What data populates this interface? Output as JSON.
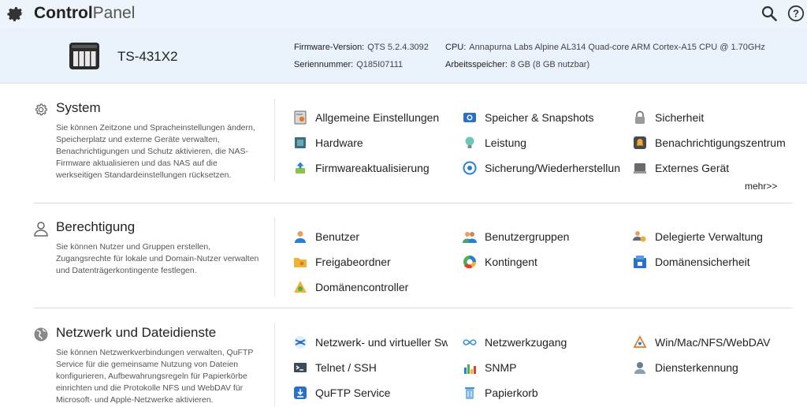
{
  "header": {
    "title_bold": "Control",
    "title_light": "Panel"
  },
  "device": {
    "model": "TS-431X2",
    "firmware_label": "Firmware-Version:",
    "firmware_value": "QTS 5.2.4.3092",
    "serial_label": "Seriennummer:",
    "serial_value": "Q185I07111",
    "cpu_label": "CPU:",
    "cpu_value": "Annapurna Labs Alpine AL314 Quad-core ARM Cortex-A15 CPU @ 1.70GHz",
    "memory_label": "Arbeitsspeicher:",
    "memory_value": "8 GB (8 GB nutzbar)"
  },
  "sections": {
    "system": {
      "title": "System",
      "desc": "Sie können Zeitzone und Spracheinstellungen ändern, Speicherplatz und externe Geräte verwalten, Benachrichtigungen und Schutz aktivieren, die NAS-Firmware aktualisieren und das NAS auf die werkseitigen Standardeinstellungen rücksetzen.",
      "items": [
        "Allgemeine Einstellungen",
        "Speicher & Snapshots",
        "Sicherheit",
        "Hardware",
        "Leistung",
        "Benachrichtigungszentrum",
        "Firmwareaktualisierung",
        "Sicherung/Wiederherstellung",
        "Externes Gerät"
      ],
      "more": "mehr>>"
    },
    "privilege": {
      "title": "Berechtigung",
      "desc": "Sie können Nutzer und Gruppen erstellen, Zugangsrechte für lokale und Domain-Nutzer verwalten und Datenträgerkontingente festlegen.",
      "items": [
        "Benutzer",
        "Benutzergruppen",
        "Delegierte Verwaltung",
        "Freigabeordner",
        "Kontingent",
        "Domänensicherheit",
        "Domänencontroller"
      ]
    },
    "network": {
      "title": "Netzwerk und Dateidienste",
      "desc": "Sie können Netzwerkverbindungen verwalten, QuFTP Service für die gemeinsame Nutzung von Dateien konfigurieren, Aufbewahrungsregeln für Papierkörbe einrichten und die Protokolle NFS und WebDAV für Microsoft- und Apple-Netzwerke aktivieren.",
      "items": [
        "Netzwerk- und virtueller Switch",
        "Netzwerkzugang",
        "Win/Mac/NFS/WebDAV",
        "Telnet / SSH",
        "SNMP",
        "Diensterkennung",
        "QuFTP Service",
        "Papierkorb"
      ]
    }
  },
  "colors": {
    "header_bg": "#eef4fb",
    "device_bg": "#e9f1fa",
    "accent_blue": "#2a7fd4"
  }
}
